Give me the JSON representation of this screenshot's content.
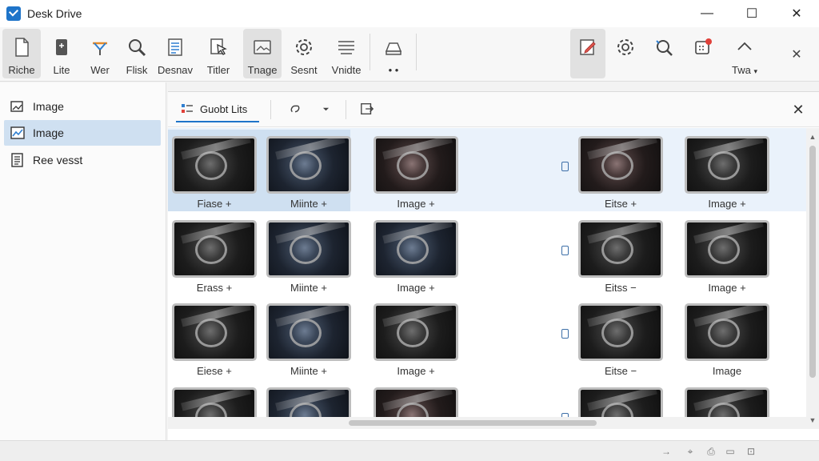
{
  "window": {
    "title": "Desk Drive",
    "minimize": "—",
    "maximize": "☐",
    "close": "✕"
  },
  "ribbon": {
    "buttons": [
      {
        "label": "Riche",
        "icon": "page-icon"
      },
      {
        "label": "Lite",
        "icon": "tablet-icon"
      },
      {
        "label": "Wer",
        "icon": "share-icon"
      },
      {
        "label": "Flisk",
        "icon": "magnifier-icon"
      },
      {
        "label": "Desnav",
        "icon": "list-doc-icon"
      },
      {
        "label": "Titler",
        "icon": "cursor-doc-icon"
      },
      {
        "label": "Tnage",
        "icon": "image-folder-icon"
      },
      {
        "label": "Sesnt",
        "icon": "gear-icon"
      },
      {
        "label": "Vnidte",
        "icon": "lines-icon"
      },
      {
        "label": "• •",
        "icon": "drive-icon"
      }
    ],
    "right": {
      "collapse_label": "Twa",
      "chevron": "▾",
      "close": "✕"
    }
  },
  "sidebar": {
    "items": [
      {
        "label": "Image",
        "icon": "image-edit-icon"
      },
      {
        "label": "Image",
        "icon": "chart-image-icon"
      },
      {
        "label": "Ree vesst",
        "icon": "document-list-icon"
      }
    ]
  },
  "panel": {
    "tab_label": "Guobt Lits",
    "close": "✕",
    "tiles": [
      [
        "Fiase +",
        "Miinte +",
        "Image +",
        "Eitse +",
        "Image +"
      ],
      [
        "Erass +",
        "Miinte +",
        "Image +",
        "Eitss −",
        "Image +"
      ],
      [
        "Eiese +",
        "Miinte +",
        "Image +",
        "Eitse −",
        "Image"
      ],
      [
        "",
        "",
        "",
        "",
        ""
      ]
    ]
  }
}
